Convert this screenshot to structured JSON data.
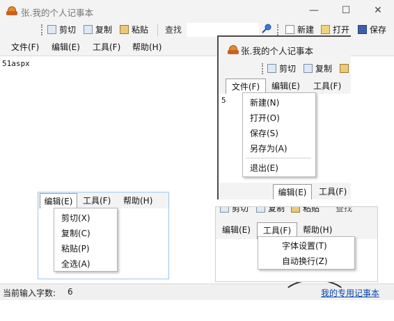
{
  "window": {
    "title": "张.我的个人记事本",
    "controls": [
      "—",
      "☐",
      "✕"
    ]
  },
  "toolbar": {
    "cut": "剪切",
    "copy": "复制",
    "paste": "粘贴",
    "search_label": "查找",
    "new": "新建",
    "open": "打开",
    "save": "保存"
  },
  "menu": {
    "file": "文件(F)",
    "edit": "编辑(E)",
    "tools": "工具(F)",
    "help": "帮助(H)"
  },
  "editor": {
    "content": "51aspx"
  },
  "status": {
    "count_label": "当前输入字数:",
    "count_value": "6",
    "link": "我的专用记事本"
  },
  "file_popup": {
    "title": "张.我的个人记事本",
    "cut": "剪切",
    "copy": "复制",
    "file_tab": "文件(F)",
    "edit_tab": "编辑(E)",
    "tools_tab": "工具(F)",
    "items": [
      "新建(N)",
      "打开(O)",
      "保存(S)",
      "另存为(A)",
      "退出(E)"
    ],
    "bottom_edit": "编辑(E)",
    "bottom_tools": "工具(F)",
    "peek_char": "5"
  },
  "edit_popup": {
    "edit_tab": "编辑(E)",
    "tools_tab": "工具(F)",
    "help_tab": "帮助(H)",
    "items": [
      "剪切(X)",
      "复制(C)",
      "粘贴(P)",
      "全选(A)"
    ]
  },
  "tools_popup": {
    "cut": "剪切",
    "copy": "复制",
    "paste": "粘贴",
    "search_label": "查找",
    "edit_tab": "编辑(E)",
    "tools_tab": "工具(F)",
    "help_tab": "帮助(H)",
    "items": [
      "字体设置(T)",
      "自动换行(Z)"
    ]
  },
  "colors": {
    "link": "#0645ad",
    "chrome": "#f3f3f3",
    "popup_border_blue": "#9cc7ee"
  }
}
